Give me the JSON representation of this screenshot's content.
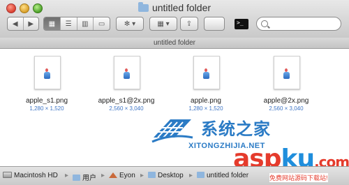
{
  "window": {
    "title": "untitled folder",
    "tab_label": "untitled folder"
  },
  "toolbar": {
    "nav": [
      "◀",
      "▶"
    ],
    "views": [
      "▦",
      "☰",
      "▥",
      "▭"
    ],
    "action": "✻ ▾",
    "arrange": "▦ ▾",
    "share": "⇪",
    "search_placeholder": ""
  },
  "files": [
    {
      "name": "apple_s1.png",
      "dimensions": "1,280 × 1,520"
    },
    {
      "name": "apple_s1@2x.png",
      "dimensions": "2,560 × 3,040"
    },
    {
      "name": "apple.png",
      "dimensions": "1,280 × 1,520"
    },
    {
      "name": "apple@2x.png",
      "dimensions": "2,560 × 3,040"
    }
  ],
  "watermark": {
    "cn": "系统之家",
    "en": "XITONGZHIJIA.NET",
    "asp_a": "asp",
    "asp_k": "ku",
    "asp_tld": ".com",
    "asp_sub": "免费网站源码下载站!"
  },
  "pathbar": {
    "items": [
      "Macintosh HD",
      "用户",
      "Eyon",
      "Desktop",
      "untitled folder"
    ],
    "separator": "▸"
  },
  "colors": {
    "accent": "#3f76c6",
    "watermark_blue": "#2b7bc5",
    "watermark_red": "#e53b2c"
  }
}
